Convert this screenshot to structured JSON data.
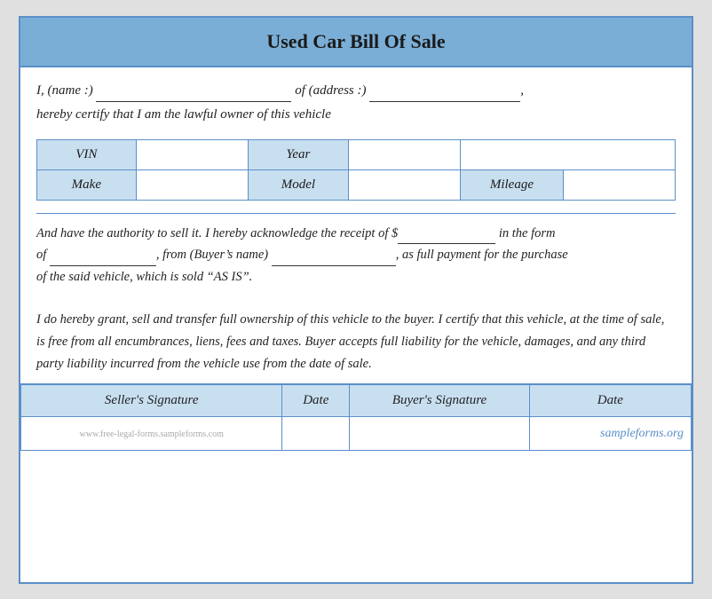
{
  "document": {
    "title": "Used Car Bill Of Sale",
    "intro": {
      "line1_prefix": "I, (name :)",
      "line1_middle": "of (address :)",
      "line2": "hereby certify that I am the lawful owner of this vehicle"
    },
    "vehicle_fields": {
      "row1": [
        {
          "label": "VIN",
          "value": ""
        },
        {
          "label": "Year",
          "value": ""
        }
      ],
      "row2": [
        {
          "label": "Make",
          "value": ""
        },
        {
          "label": "Model",
          "value": ""
        },
        {
          "label": "Mileage",
          "value": ""
        }
      ]
    },
    "authority_text": "And have the authority to sell it. I hereby acknowledge the receipt of $            in the form of              , from (Buyer’s name)                  , as full payment for the purchase of the said vehicle, which is sold “AS IS”.",
    "ownership_text": "I do hereby grant, sell and transfer full ownership of this vehicle to the buyer. I certify that this vehicle, at the time of sale, is free from all encumbrances, liens, fees and taxes. Buyer accepts full liability for the vehicle, damages, and any third party liability incurred from the vehicle use from the date of sale.",
    "signature_labels": {
      "seller_sig": "Seller's Signature",
      "date1": "Date",
      "buyer_sig": "Buyer's Signature",
      "date2": "Date"
    },
    "watermark": "www.free-legal-forms.sampleforms.com",
    "sampleforms": "sampleforms.org"
  }
}
